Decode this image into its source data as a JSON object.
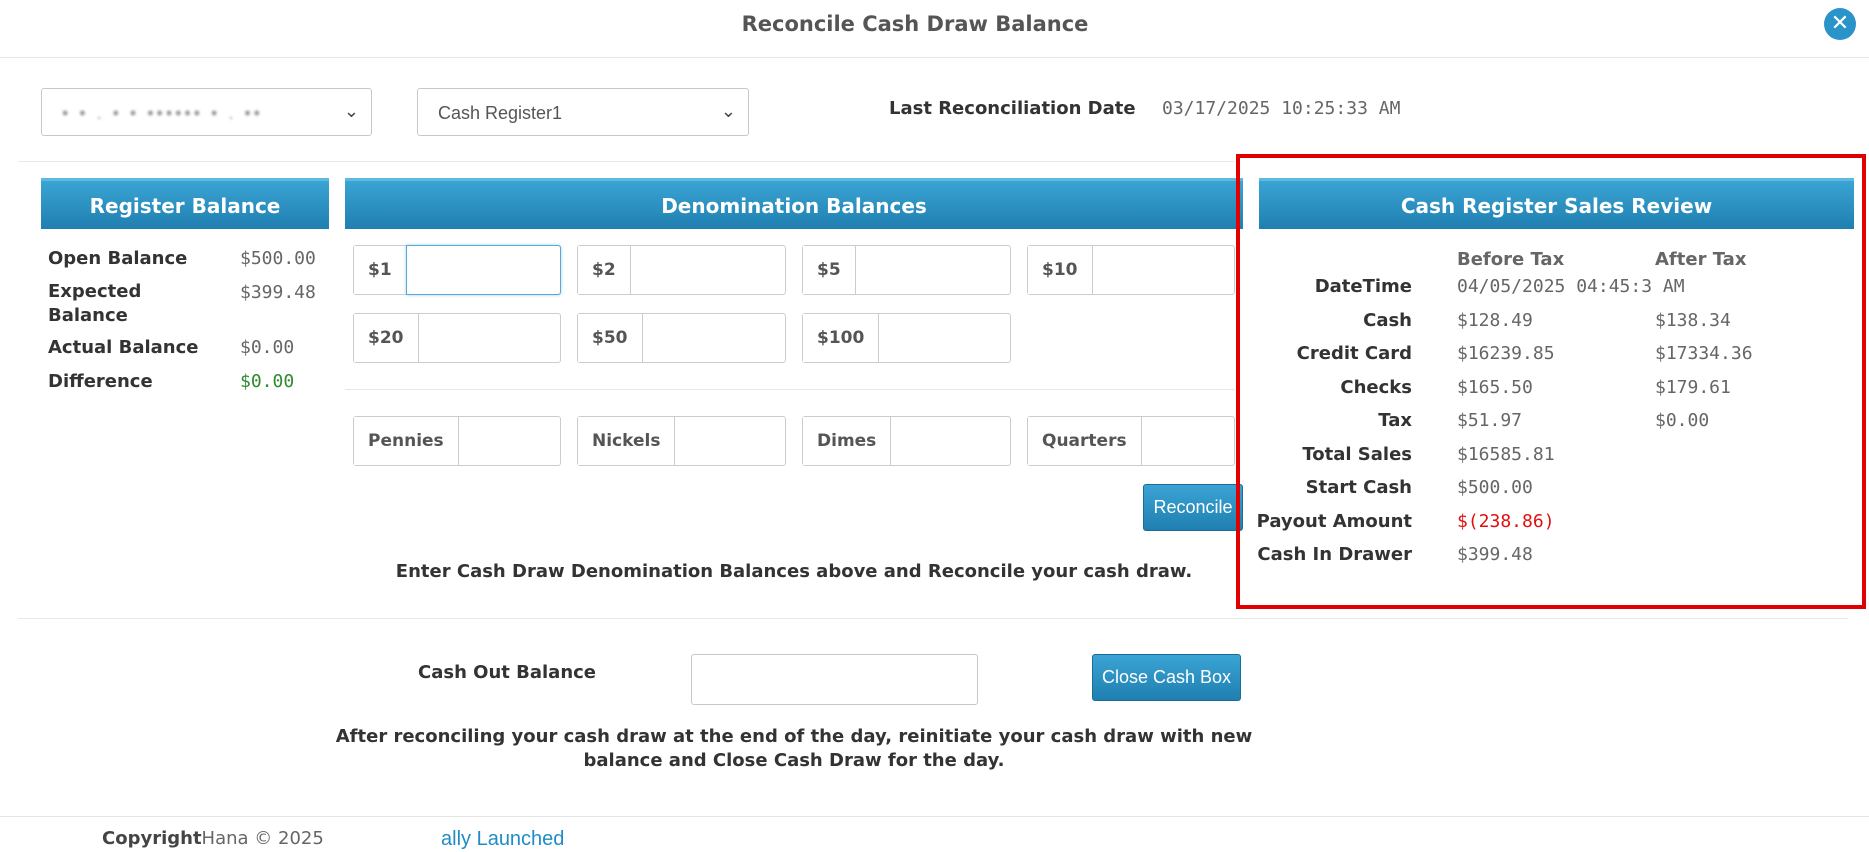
{
  "dialog": {
    "title": "Reconcile Cash Draw Balance",
    "close_icon": "close-icon"
  },
  "top": {
    "location_select_value": "• • . • • •••••• • . ••",
    "register_select_value": "Cash Register1",
    "last_recon_label": "Last Reconciliation Date",
    "last_recon_value": "03/17/2025 10:25:33 AM"
  },
  "register_balance": {
    "title": "Register Balance",
    "rows": [
      {
        "label": "Open Balance",
        "value": "$500.00"
      },
      {
        "label": "Expected Balance",
        "value": "$399.48"
      },
      {
        "label": "Actual Balance",
        "value": "$0.00"
      },
      {
        "label": "Difference",
        "value": "$0.00"
      }
    ],
    "difference_color": "#2e8b2e"
  },
  "denominations": {
    "title": "Denomination Balances",
    "bills": [
      "$1",
      "$2",
      "$5",
      "$10",
      "$20",
      "$50",
      "$100"
    ],
    "coins": [
      "Pennies",
      "Nickels",
      "Dimes",
      "Quarters"
    ],
    "reconcile_label": "Reconcile",
    "note": "Enter Cash Draw Denomination Balances above and Reconcile your cash draw."
  },
  "review": {
    "title": "Cash Register Sales Review",
    "col_before": "Before Tax",
    "col_after": "After Tax",
    "rows": [
      {
        "label": "DateTime",
        "before": "04/05/2025 04:45:3 AM",
        "after": ""
      },
      {
        "label": "Cash",
        "before": "$128.49",
        "after": "$138.34"
      },
      {
        "label": "Credit Card",
        "before": "$16239.85",
        "after": "$17334.36"
      },
      {
        "label": "Checks",
        "before": "$165.50",
        "after": "$179.61"
      },
      {
        "label": "Tax",
        "before": "$51.97",
        "after": "$0.00"
      },
      {
        "label": "Total Sales",
        "before": "$16585.81",
        "after": ""
      },
      {
        "label": "Start Cash",
        "before": "$500.00",
        "after": ""
      },
      {
        "label": "Payout Amount",
        "before": "$(238.86)",
        "after": ""
      },
      {
        "label": "Cash In Drawer",
        "before": "$399.48",
        "after": ""
      }
    ],
    "payout_color": "#e01010",
    "highlight_color": "#e00000"
  },
  "cash_out": {
    "label": "Cash Out Balance",
    "input_value": "",
    "close_button_label": "Close Cash Box",
    "note_line1": "After reconciling your cash draw at the end of the day, reinitiate your cash draw with new",
    "note_line2": "balance and Close Cash Draw for the day."
  },
  "footer": {
    "copyright_bold": "Copyright",
    "copyright_rest": "Hana © 2025",
    "link": "ally Launched"
  },
  "colors": {
    "accent": "#2a93c9",
    "header_gradient_top": "#3aa4d4",
    "header_gradient_bottom": "#1f7fb0"
  }
}
